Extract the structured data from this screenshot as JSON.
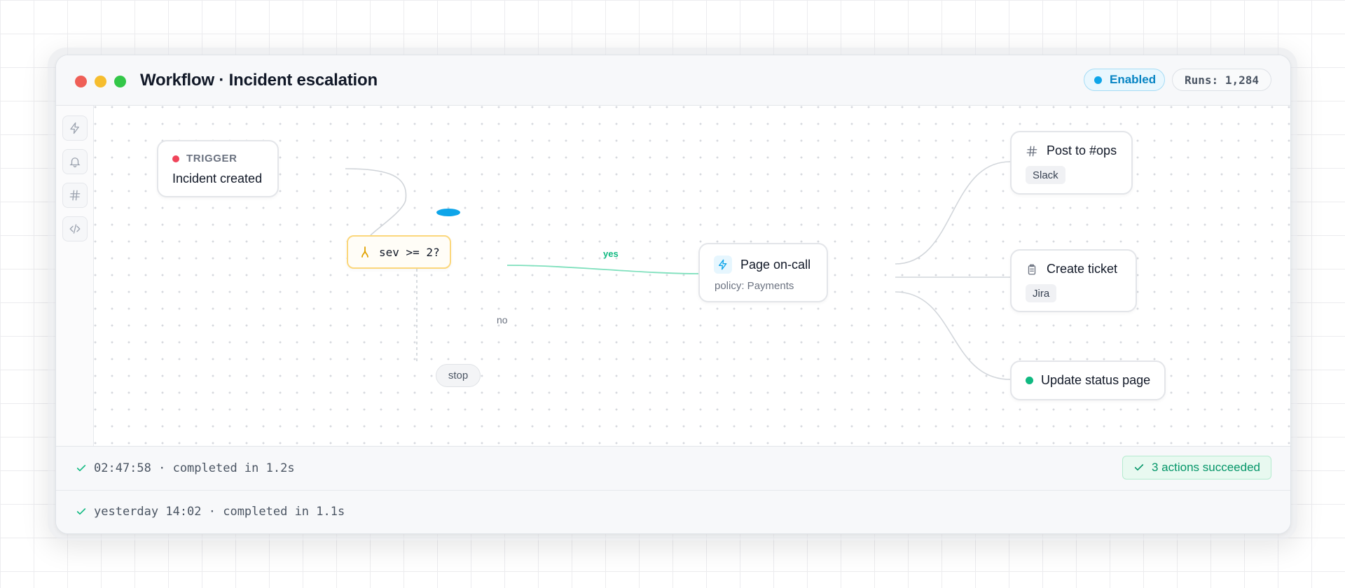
{
  "window": {
    "title": "Workflow · Incident escalation",
    "status_badge": "Enabled",
    "runs_badge": "Runs: 1,284"
  },
  "sidebar": {
    "tools": [
      {
        "icon": "bolt-icon"
      },
      {
        "icon": "bell-icon"
      },
      {
        "icon": "hash-icon"
      },
      {
        "icon": "code-icon"
      }
    ]
  },
  "flow": {
    "trigger": {
      "label": "TRIGGER",
      "title": "Incident created"
    },
    "condition": {
      "expression": "sev >= 2?",
      "icon": "branch-icon"
    },
    "edges": {
      "yes": "yes",
      "no": "no"
    },
    "stop": "stop",
    "page": {
      "title": "Page on-call",
      "subtitle": "policy: Payments",
      "icon": "bolt-icon"
    },
    "actions": [
      {
        "title": "Post to #ops",
        "tag": "Slack",
        "icon": "hash-icon"
      },
      {
        "title": "Create ticket",
        "tag": "Jira",
        "icon": "clipboard-icon"
      },
      {
        "title": "Update status page",
        "icon": "status-dot-icon"
      }
    ]
  },
  "runs": [
    {
      "text": "02:47:58 · completed in 1.2s",
      "badge": "3 actions succeeded"
    },
    {
      "text": "yesterday 14:02 · completed in 1.1s"
    }
  ],
  "colors": {
    "accent": "#0ea5e9",
    "success": "#10b981",
    "trigger": "#f0445a",
    "condition_border": "#fbd77c"
  }
}
